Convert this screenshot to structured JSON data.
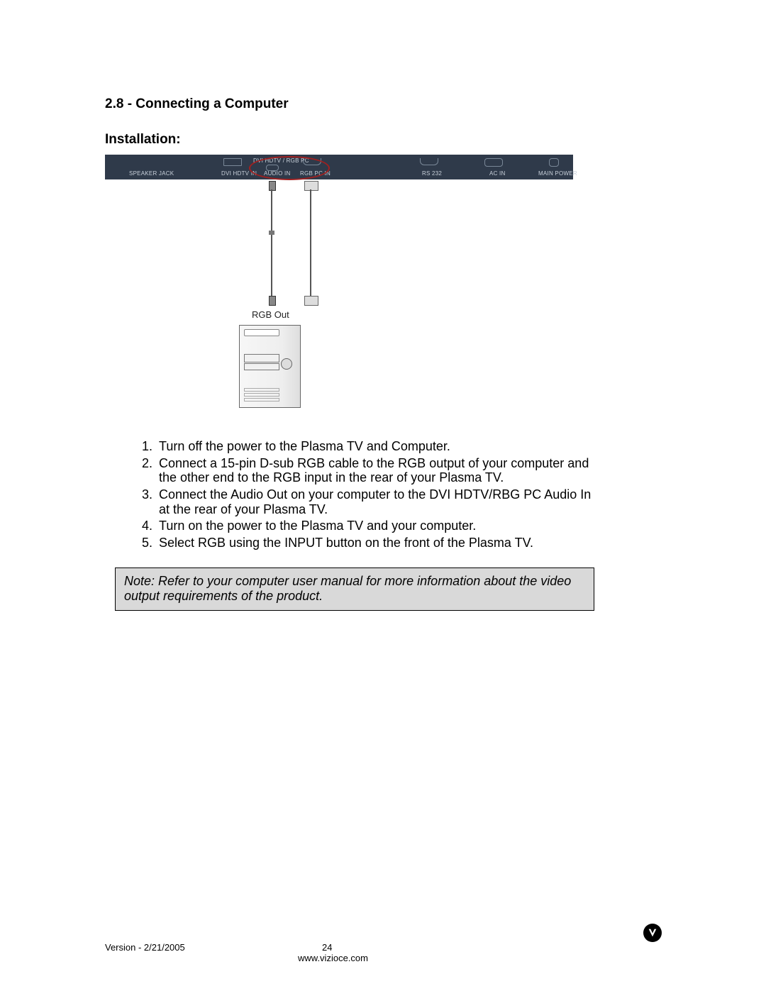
{
  "heading": "2.8 - Connecting a Computer",
  "subheading": "Installation:",
  "panel": {
    "ports": {
      "speaker": "SPEAKER JACK",
      "dvi_in": "DVI HDTV IN",
      "dvi_rgb_top": "DVI HDTV / RGB PC",
      "audio_in": "AUDIO IN",
      "rgb_pc_in": "RGB PC IN",
      "rs232": "RS 232",
      "ac_in": "AC IN",
      "main_power": "MAIN POWER"
    }
  },
  "diagram": {
    "rgb_out_label": "RGB Out"
  },
  "steps": [
    "Turn off the power to the Plasma TV and Computer.",
    "Connect a 15-pin D-sub RGB cable to the RGB output of your computer and the other end to the RGB input in the rear of your Plasma TV.",
    "Connect the Audio Out on your computer to the DVI HDTV/RBG PC Audio In at the rear of your Plasma TV.",
    "Turn on the power to the Plasma TV and your computer.",
    "Select RGB using the INPUT button on the front of the Plasma TV."
  ],
  "note": "Note: Refer to your computer user manual for more information about the video output requirements of the product.",
  "footer": {
    "version": "Version - 2/21/2005",
    "page": "24",
    "url": "www.vizioce.com"
  }
}
